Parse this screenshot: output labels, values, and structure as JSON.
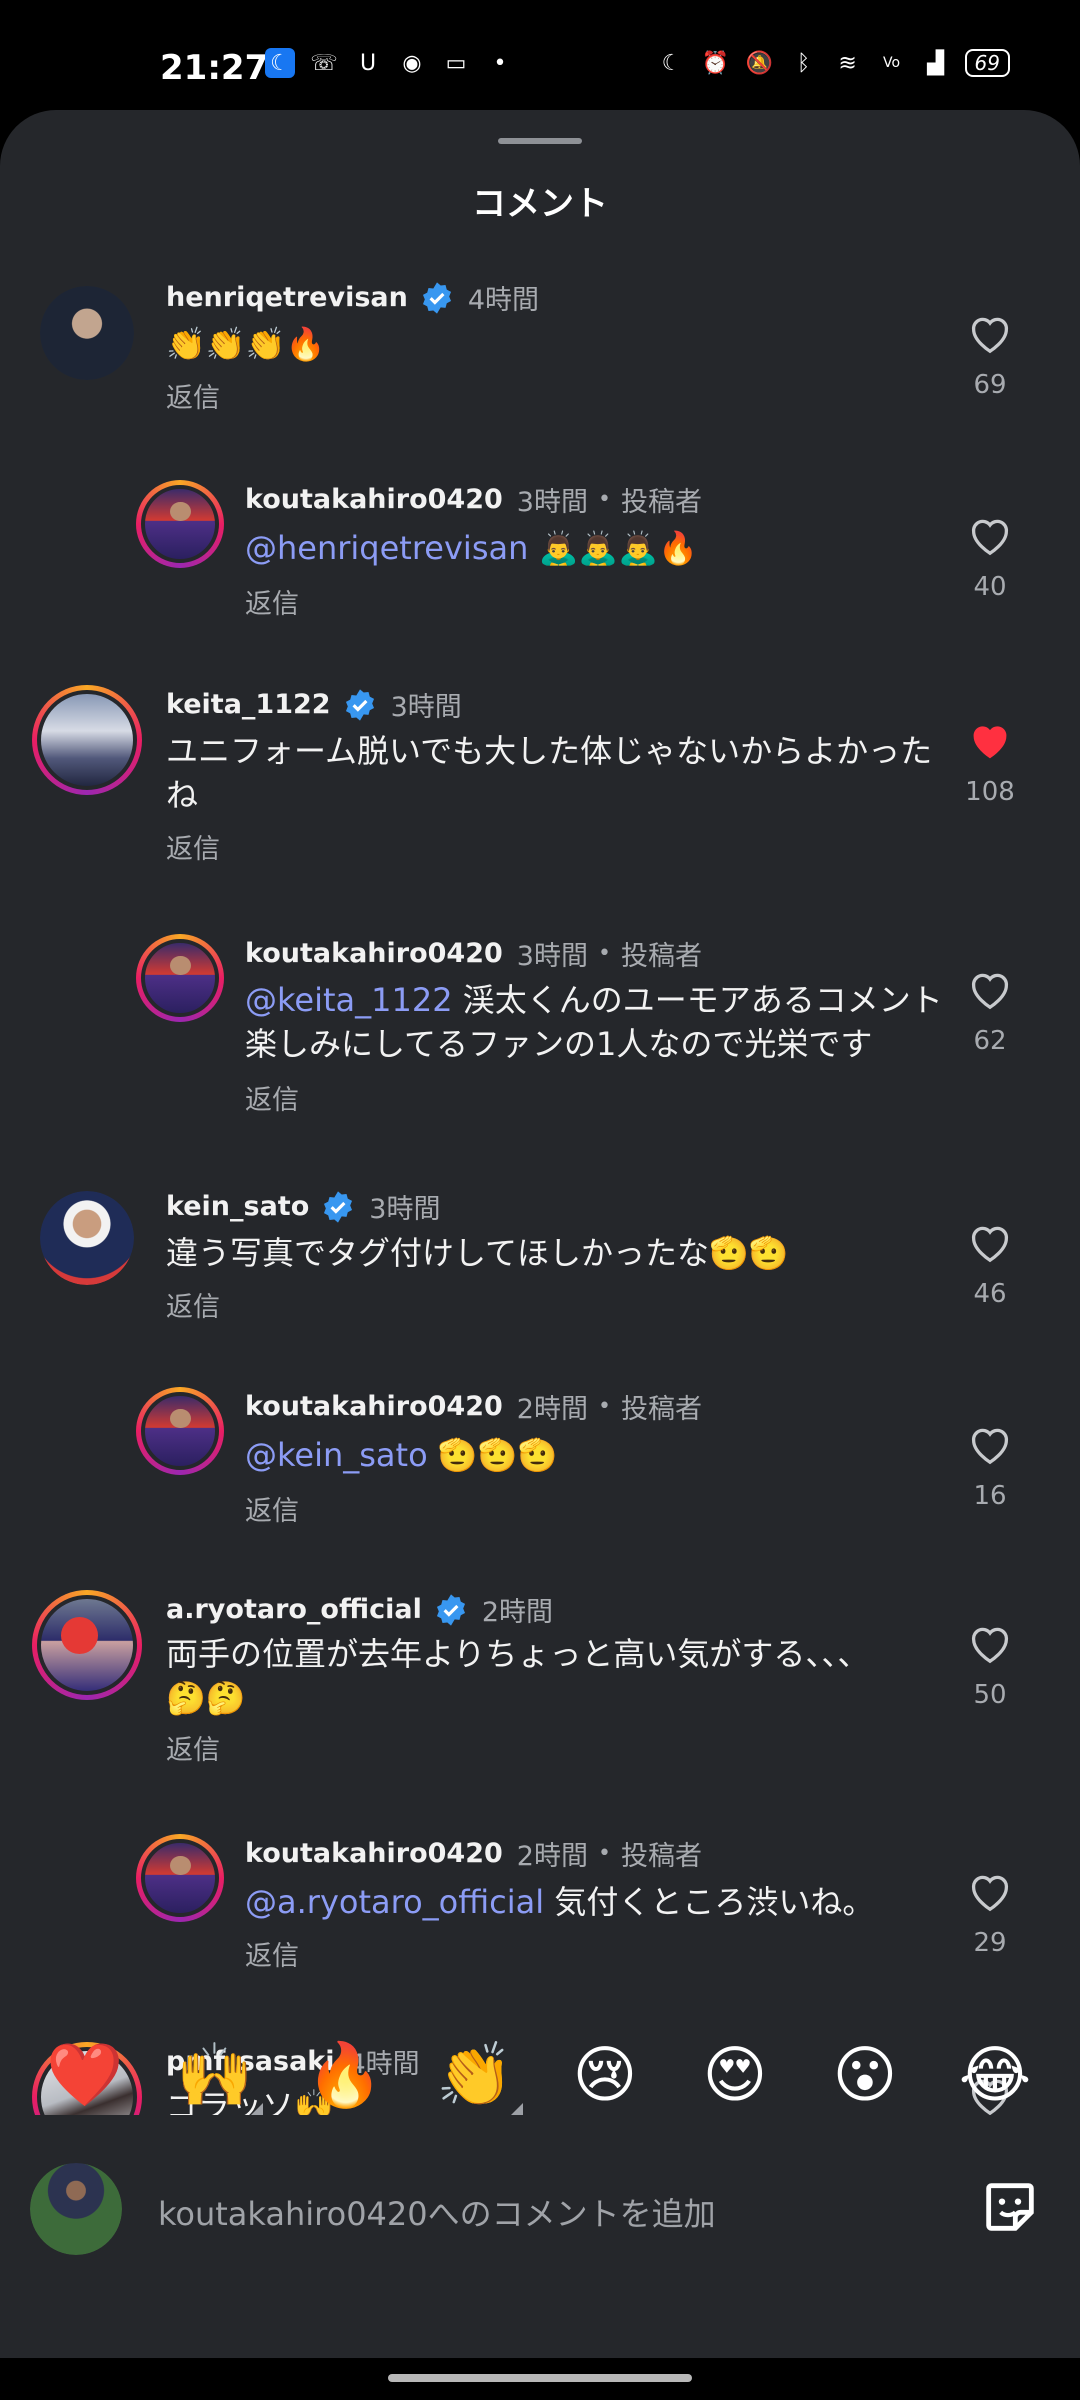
{
  "status_bar": {
    "time": "21:27",
    "battery": "69",
    "left_icons": [
      "facebook-icon",
      "missed-call-icon",
      "u-app-icon",
      "line-icon",
      "video-icon",
      "dot-icon"
    ],
    "right_icons": [
      "moon-icon",
      "alarm-icon",
      "silent-icon",
      "bluetooth-icon",
      "wifi-icon",
      "volte-icon",
      "signal-icon",
      "battery-icon"
    ]
  },
  "sheet": {
    "title": "コメント"
  },
  "comments": [
    {
      "username": "henriqetrevisan",
      "verified": true,
      "time": "4時間",
      "text": "👏👏👏🔥",
      "reply": "返信",
      "likes": "69",
      "liked": false
    },
    {
      "username": "koutakahiro0420",
      "time": "3時間",
      "author_label": "投稿者",
      "mention": "@henriqetrevisan",
      "text": " 🙇‍♂️🙇‍♂️🙇‍♂️🔥",
      "reply": "返信",
      "likes": "40",
      "liked": false
    },
    {
      "username": "keita_1122",
      "verified": true,
      "time": "3時間",
      "text": "ユニフォーム脱いでも大した体じゃないからよかった\nね",
      "reply": "返信",
      "likes": "108",
      "liked": true
    },
    {
      "username": "koutakahiro0420",
      "time": "3時間",
      "author_label": "投稿者",
      "mention": "@keita_1122",
      "text": " 渓太くんのユーモアあるコメント\n楽しみにしてるファンの1人なので光栄です",
      "reply": "返信",
      "likes": "62",
      "liked": false
    },
    {
      "username": "kein_sato",
      "verified": true,
      "time": "3時間",
      "text": "違う写真でタグ付けしてほしかったな🫡🫡",
      "reply": "返信",
      "likes": "46",
      "liked": false
    },
    {
      "username": "koutakahiro0420",
      "time": "2時間",
      "author_label": "投稿者",
      "mention": "@kein_sato",
      "text": " 🫡🫡🫡",
      "reply": "返信",
      "likes": "16",
      "liked": false
    },
    {
      "username": "a.ryotaro_official",
      "verified": true,
      "time": "2時間",
      "text": "両手の位置が去年よりちょっと高い気がする、、、\n🤔🤔",
      "reply": "返信",
      "likes": "50",
      "liked": false
    },
    {
      "username": "koutakahiro0420",
      "time": "2時間",
      "author_label": "投稿者",
      "mention": "@a.ryotaro_official",
      "text": " 気付くところ渋いね。",
      "reply": "返信",
      "likes": "29",
      "liked": false
    },
    {
      "username": "pmf_sasaki",
      "time": "4時間",
      "text": "ゴラッソ🙌",
      "likes": "",
      "liked": false
    }
  ],
  "emoji_bar": [
    "❤️",
    "🙌",
    "🔥",
    "👏",
    "😢",
    "😍",
    "😮",
    "😂"
  ],
  "composer": {
    "placeholder": "koutakahiro0420へのコメントを追加"
  },
  "colors": {
    "sheet_bg": "#25272b",
    "mention": "#8c9cf5",
    "liked": "#ff3040",
    "verified": "#3897f0"
  }
}
